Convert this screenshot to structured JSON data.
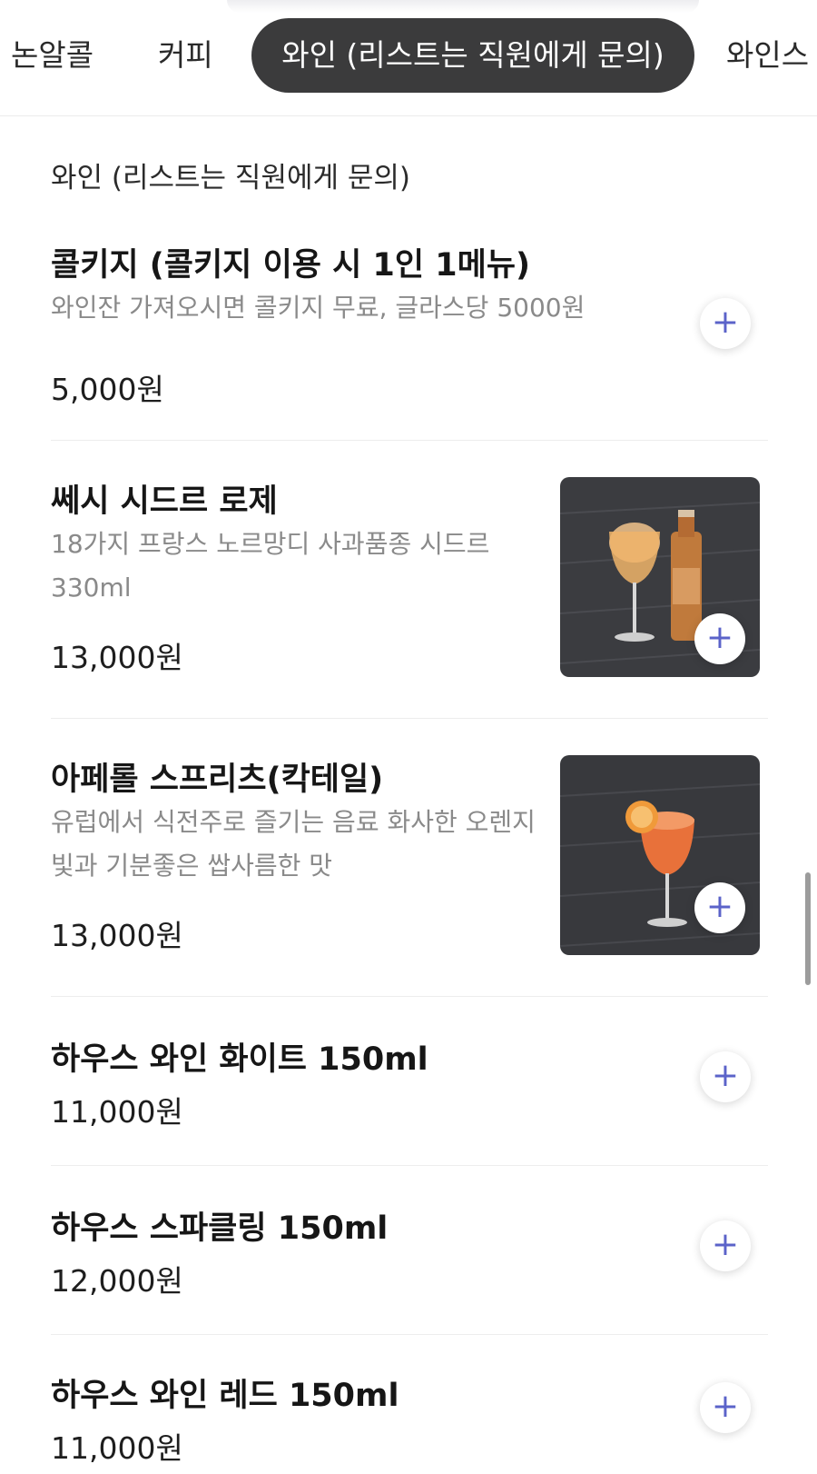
{
  "tabs": [
    {
      "label": "논알콜"
    },
    {
      "label": "커피"
    },
    {
      "label": "와인 (리스트는 직원에게 문의)"
    },
    {
      "label": "와인스"
    }
  ],
  "section": {
    "title": "와인 (리스트는 직원에게 문의)"
  },
  "add_icon": "plus-icon",
  "accent": "#5b63c9",
  "items": [
    {
      "name": "콜키지 (콜키지 이용 시 1인 1메뉴)",
      "desc": "와인잔 가져오시면 콜키지 무료, 글라스당 5000원",
      "price": "5,000원"
    },
    {
      "name": "쎄시 시드르 로제",
      "desc": "18가지 프랑스 노르망디 사과품종 시드르 330ml",
      "price": "13,000원"
    },
    {
      "name": "아페롤 스프리츠(칵테일)",
      "desc": "유럽에서 식전주로 즐기는 음료 화사한 오렌지빛과 기분좋은 쌉사름한 맛",
      "price": "13,000원"
    },
    {
      "name": "하우스 와인 화이트 150ml",
      "price": "11,000원"
    },
    {
      "name": "하우스 스파클링 150ml",
      "price": "12,000원"
    },
    {
      "name": "하우스 와인 레드 150ml",
      "price": "11,000원"
    }
  ]
}
